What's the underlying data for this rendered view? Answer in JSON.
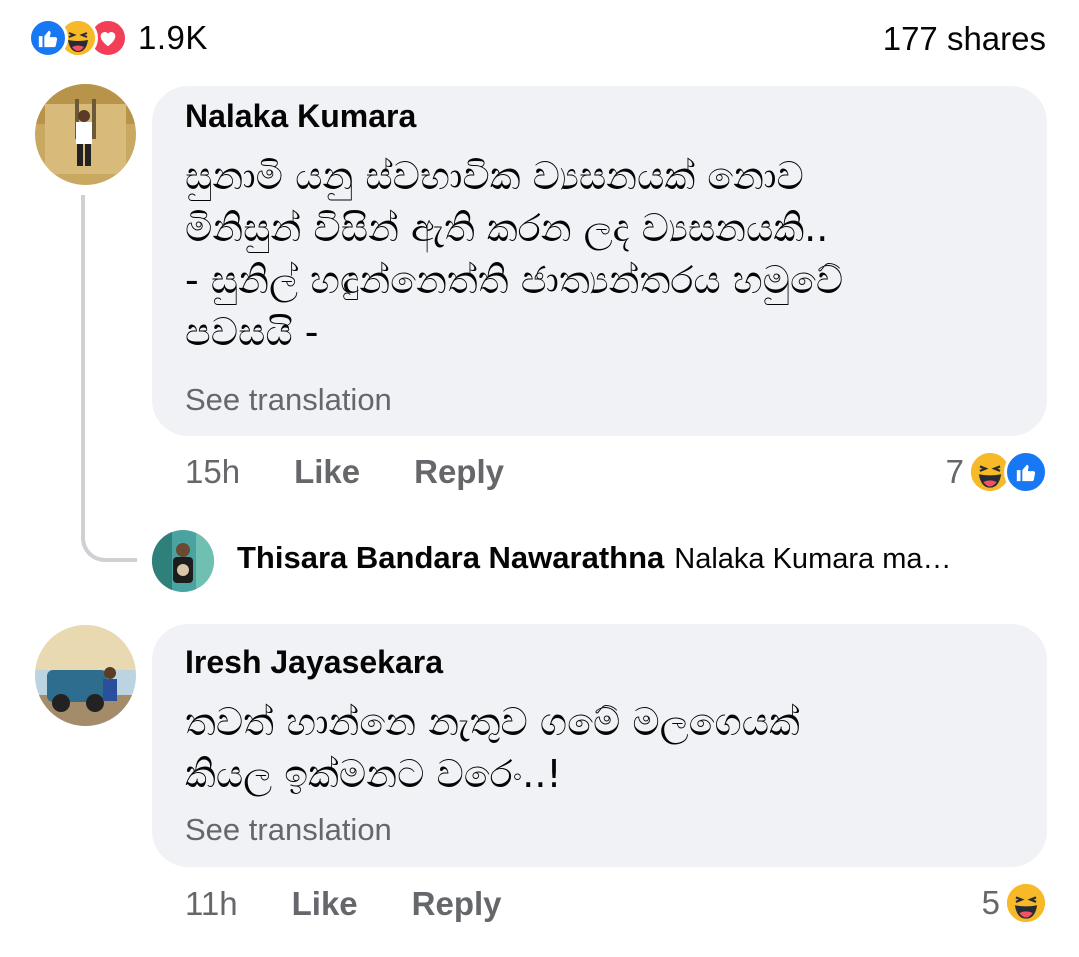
{
  "post_stats": {
    "reaction_icons": [
      "like-icon",
      "haha-icon",
      "love-icon"
    ],
    "reaction_count": "1.9K",
    "shares": "177 shares"
  },
  "comments": [
    {
      "author": "Nalaka Kumara",
      "text_lines": [
        "සුනාමි යනු ස්වභාවික ව්‍යසනයක් නොව",
        "මිනිසුන් විසින් ඇති කරන ලද ව්‍යසනයකි..",
        "- සුනිල් හඳුන්නෙත්ති ජාත්‍යන්තරය හමුවේ",
        "පවසයි -"
      ],
      "see_translation": "See translation",
      "time": "15h",
      "like": "Like",
      "reply": "Reply",
      "reaction_count": "7",
      "reaction_icons": [
        "haha-icon",
        "like-icon"
      ]
    },
    {
      "author": "Iresh Jayasekara",
      "text_lines": [
        "තවත් හාන්නෙ නැතුව ගමේ මලගෙයක්",
        "කියල ඉක්මනට වරෙං..!"
      ],
      "see_translation": "See translation",
      "time": "11h",
      "like": "Like",
      "reply": "Reply",
      "reaction_count": "5",
      "reaction_icons": [
        "haha-icon"
      ]
    }
  ],
  "reply_preview": {
    "author": "Thisara Bandara Nawarathna",
    "text": "Nalaka Kumara ma…"
  },
  "colors": {
    "like_blue": "#1877f2",
    "haha_yellow": "#f7b928",
    "love_red": "#f33e58",
    "bubble_bg": "#f0f2f5",
    "secondary_text": "#65676b"
  }
}
